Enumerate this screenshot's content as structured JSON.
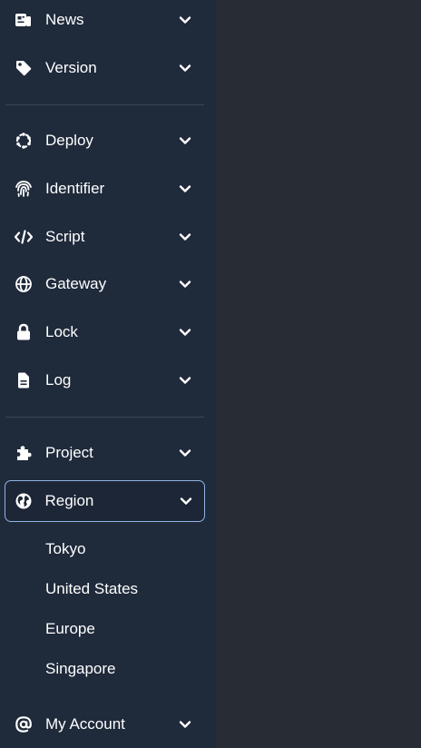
{
  "sidebar": {
    "items": [
      {
        "label": "News",
        "icon": "news-icon"
      },
      {
        "label": "Version",
        "icon": "tag-icon"
      },
      {
        "label": "Deploy",
        "icon": "deploy-icon"
      },
      {
        "label": "Identifier",
        "icon": "fingerprint-icon"
      },
      {
        "label": "Script",
        "icon": "code-icon"
      },
      {
        "label": "Gateway",
        "icon": "globe-icon"
      },
      {
        "label": "Lock",
        "icon": "lock-icon"
      },
      {
        "label": "Log",
        "icon": "file-icon"
      },
      {
        "label": "Project",
        "icon": "puzzle-icon"
      },
      {
        "label": "Region",
        "icon": "earth-icon",
        "expanded": true
      },
      {
        "label": "My Account",
        "icon": "at-icon"
      }
    ],
    "region_sub_items": [
      "Tokyo",
      "United States",
      "Europe",
      "Singapore"
    ]
  },
  "colors": {
    "sidebar_bg": "#1f2a3b",
    "main_bg": "#282c35",
    "active_border": "#8fb4e6",
    "divider": "#3a4658",
    "text": "#ffffff"
  }
}
